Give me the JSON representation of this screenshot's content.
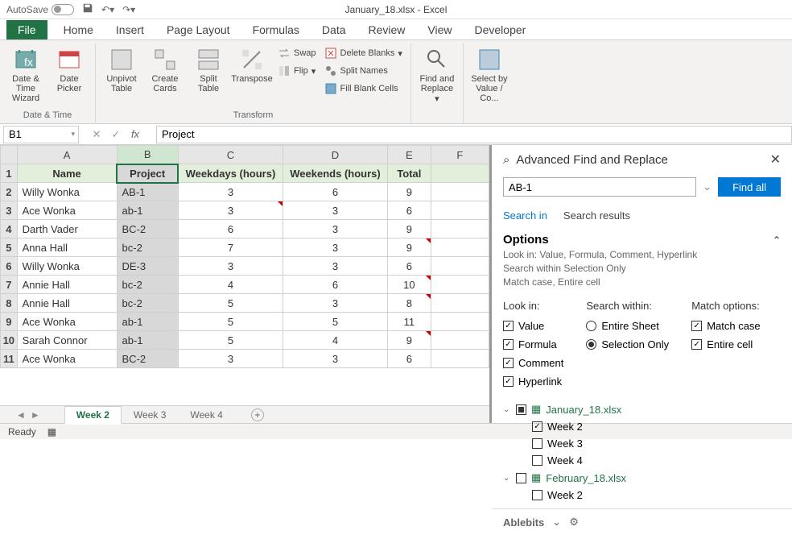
{
  "titlebar": {
    "autosave": "AutoSave",
    "doc_title": "January_18.xlsx - Excel"
  },
  "menu": {
    "file": "File",
    "items": [
      "Home",
      "Insert",
      "Page Layout",
      "Formulas",
      "Data",
      "Review",
      "View",
      "Developer"
    ]
  },
  "ribbon": {
    "groups": {
      "datetime": {
        "label": "Date & Time",
        "btn1": "Date & Time Wizard",
        "btn2": "Date Picker"
      },
      "transform": {
        "label": "Transform",
        "unpivot": "Unpivot Table",
        "create": "Create Cards",
        "split": "Split Table",
        "transpose": "Transpose",
        "swap": "Swap",
        "flip": "Flip",
        "delb": "Delete Blanks",
        "splitn": "Split Names",
        "fillb": "Fill Blank Cells"
      },
      "find": {
        "label": "",
        "find": "Find and Replace"
      },
      "select": {
        "sel": "Select by Value / Co..."
      }
    }
  },
  "formula_bar": {
    "namebox": "B1",
    "formula": "Project"
  },
  "sheet": {
    "cols": [
      "A",
      "B",
      "C",
      "D",
      "E",
      "F"
    ],
    "hdr": [
      "Name",
      "Project",
      "Weekdays (hours)",
      "Weekends (hours)",
      "Total"
    ],
    "rows": [
      {
        "name": "Willy Wonka",
        "proj": "AB-1",
        "wd": "3",
        "we": "6",
        "tot": "9"
      },
      {
        "name": "Ace Wonka",
        "proj": "ab-1",
        "wd": "3",
        "we": "3",
        "tot": "6"
      },
      {
        "name": "Darth Vader",
        "proj": "BC-2",
        "wd": "6",
        "we": "3",
        "tot": "9"
      },
      {
        "name": "Anna Hall",
        "proj": "bc-2",
        "wd": "7",
        "we": "3",
        "tot": "9"
      },
      {
        "name": "Willy Wonka",
        "proj": "DE-3",
        "wd": "3",
        "we": "3",
        "tot": "6"
      },
      {
        "name": "Annie Hall",
        "proj": "bc-2",
        "wd": "4",
        "we": "6",
        "tot": "10"
      },
      {
        "name": "Annie Hall",
        "proj": "bc-2",
        "wd": "5",
        "we": "3",
        "tot": "8"
      },
      {
        "name": "Ace Wonka",
        "proj": "ab-1",
        "wd": "5",
        "we": "5",
        "tot": "11"
      },
      {
        "name": "Sarah Connor",
        "proj": "ab-1",
        "wd": "5",
        "we": "4",
        "tot": "9"
      },
      {
        "name": "Ace Wonka",
        "proj": "BC-2",
        "wd": "3",
        "we": "3",
        "tot": "6"
      }
    ],
    "tabs": [
      "Week 2",
      "Week 3",
      "Week 4"
    ]
  },
  "status": {
    "ready": "Ready"
  },
  "pane": {
    "title": "Advanced Find and Replace",
    "search": "AB-1",
    "findall": "Find all",
    "tab_searchin": "Search in",
    "tab_results": "Search results",
    "options_hdr": "Options",
    "summary": [
      "Look in: Value, Formula, Comment, Hyperlink",
      "Search within Selection Only",
      "Match case, Entire cell"
    ],
    "lookin_hdr": "Look in:",
    "lookin": [
      "Value",
      "Formula",
      "Comment",
      "Hyperlink"
    ],
    "within_hdr": "Search within:",
    "within": [
      "Entire Sheet",
      "Selection Only"
    ],
    "match_hdr": "Match options:",
    "match": [
      "Match case",
      "Entire cell"
    ],
    "tree": [
      {
        "file": "January_18.xlsx",
        "mixed": true,
        "children": [
          {
            "name": "Week 2",
            "checked": true
          },
          {
            "name": "Week 3",
            "checked": false
          },
          {
            "name": "Week 4",
            "checked": false
          }
        ]
      },
      {
        "file": "February_18.xlsx",
        "mixed": false,
        "children": [
          {
            "name": "Week 2",
            "checked": false
          }
        ]
      }
    ],
    "footer": "Ablebits"
  }
}
